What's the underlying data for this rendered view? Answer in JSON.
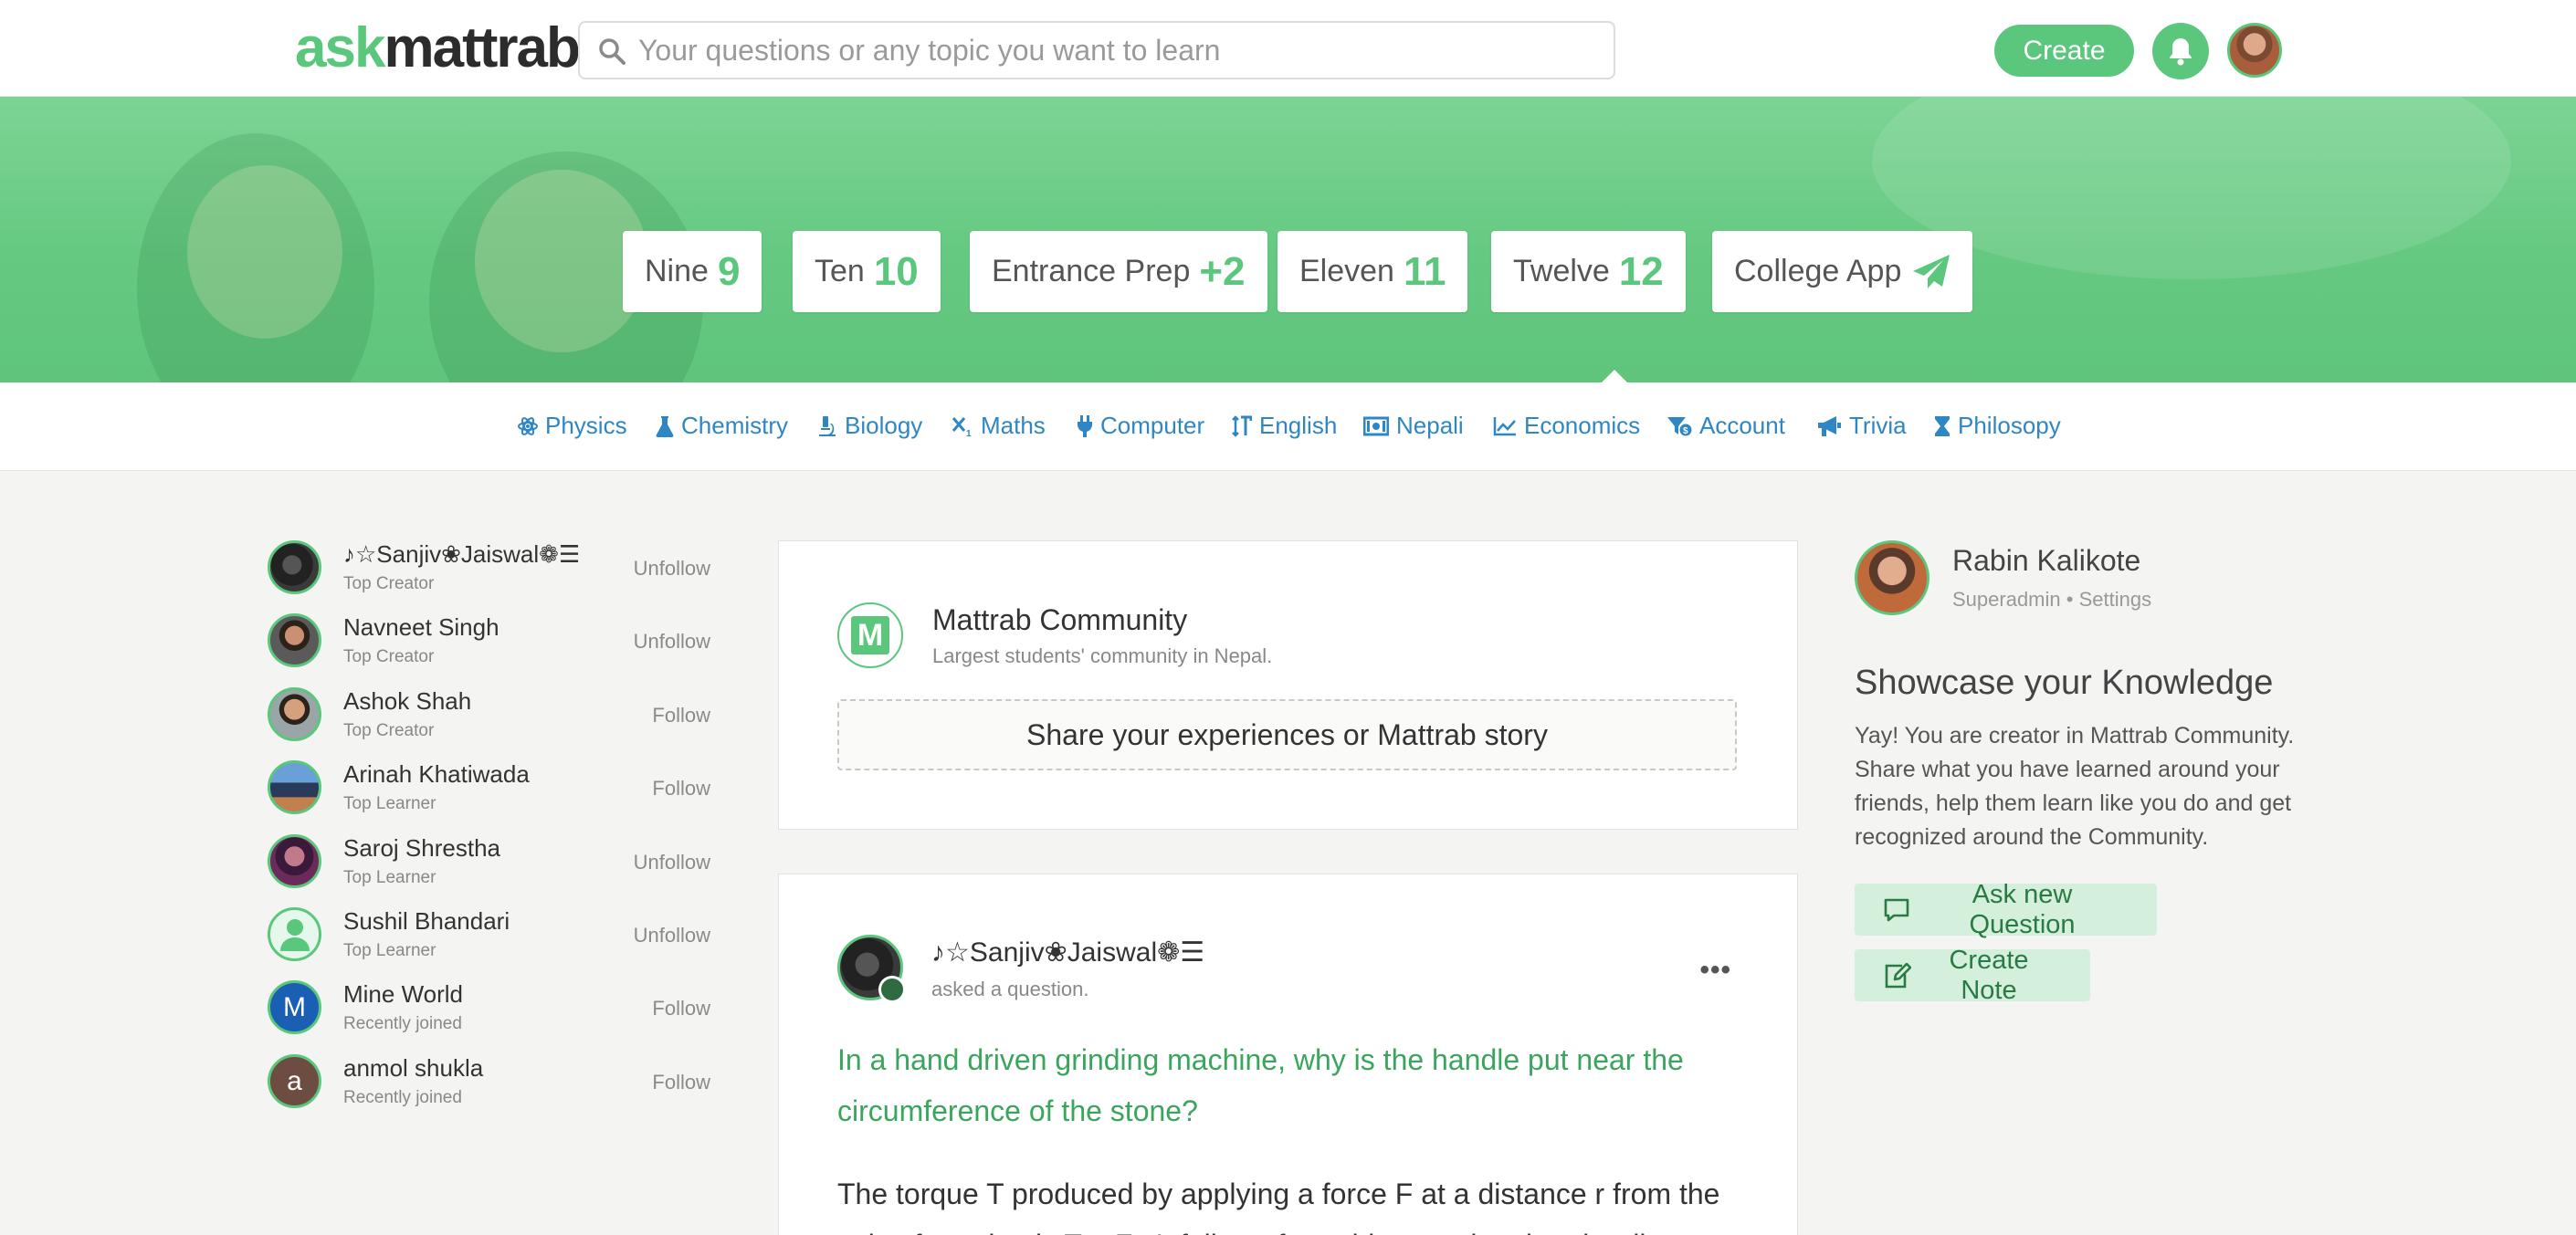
{
  "header": {
    "logo_ask": "ask",
    "logo_mattrab": "mattrab",
    "search_placeholder": "Your questions or any topic you want to learn",
    "create_label": "Create"
  },
  "grades": [
    {
      "name": "Nine",
      "num": "9"
    },
    {
      "name": "Ten",
      "num": "10"
    },
    {
      "name": "Entrance Prep",
      "num": "+2"
    },
    {
      "name": "Eleven",
      "num": "11"
    },
    {
      "name": "Twelve",
      "num": "12"
    },
    {
      "name": "College App",
      "icon": "paper-plane-icon"
    }
  ],
  "subjects": [
    {
      "label": "Physics",
      "icon": "atom-icon"
    },
    {
      "label": "Chemistry",
      "icon": "flask-icon"
    },
    {
      "label": "Biology",
      "icon": "microscope-icon"
    },
    {
      "label": "Maths",
      "icon": "subscript-icon"
    },
    {
      "label": "Computer",
      "icon": "plug-icon"
    },
    {
      "label": "English",
      "icon": "text-height-icon"
    },
    {
      "label": "Nepali",
      "icon": "money-bill-icon"
    },
    {
      "label": "Economics",
      "icon": "chart-line-icon"
    },
    {
      "label": "Account",
      "icon": "funnel-dollar-icon"
    },
    {
      "label": "Trivia",
      "icon": "bullhorn-icon"
    },
    {
      "label": "Philosopy",
      "icon": "hourglass-icon"
    }
  ],
  "people": [
    {
      "name": "♪☆Sanjiv❀Jaiswal❁☰",
      "role": "Top Creator",
      "action": "Unfollow"
    },
    {
      "name": "Navneet Singh",
      "role": "Top Creator",
      "action": "Unfollow"
    },
    {
      "name": "Ashok Shah",
      "role": "Top Creator",
      "action": "Follow"
    },
    {
      "name": "Arinah Khatiwada",
      "role": "Top Learner",
      "action": "Follow"
    },
    {
      "name": "Saroj Shrestha",
      "role": "Top Learner",
      "action": "Unfollow"
    },
    {
      "name": "Sushil Bhandari",
      "role": "Top Learner",
      "action": "Unfollow"
    },
    {
      "name": "Mine World",
      "role": "Recently joined",
      "action": "Follow",
      "initial": "M"
    },
    {
      "name": "anmol shukla",
      "role": "Recently joined",
      "action": "Follow",
      "initial": "a"
    }
  ],
  "community": {
    "logo_letter": "M",
    "title": "Mattrab Community",
    "subtitle": "Largest students' community in Nepal.",
    "share_prompt": "Share your experiences or Mattrab story"
  },
  "post": {
    "author": "♪☆Sanjiv❀Jaiswal❁☰",
    "action": "asked a question.",
    "more": "•••",
    "question": "In a hand driven grinding machine, why is the handle put near the circumference of the stone?",
    "answer": "The torque T produced by applying a force F at a distance r from the axis of rotation is T = F.r It follows from this equation that the dist..."
  },
  "profile": {
    "name": "Rabin Kalikote",
    "role": "Superadmin",
    "separator": "•",
    "settings": "Settings"
  },
  "showcase": {
    "title": "Showcase your Knowledge",
    "body": "Yay! You are creator in Mattrab Community. Share what you have learned around your friends, help them learn like you do and get recognized around the Community.",
    "ask_label": "Ask new Question",
    "note_label": "Create Note"
  },
  "colors": {
    "brand": "#5ac77c",
    "link": "#2f86c4",
    "question": "#3aa55c"
  }
}
